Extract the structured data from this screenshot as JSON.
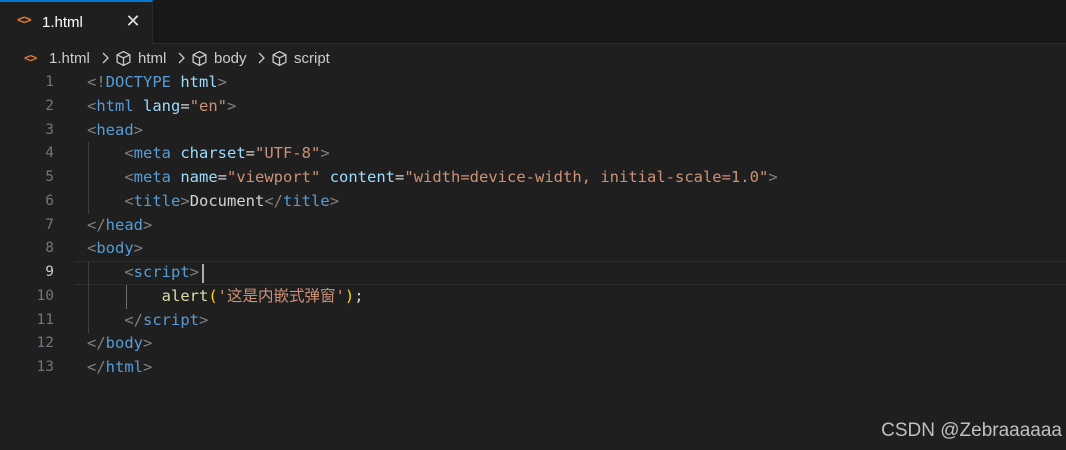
{
  "tab": {
    "icon": "<>",
    "label": "1.html",
    "close": "✕"
  },
  "breadcrumb": {
    "file_icon": "<>",
    "items": [
      "1.html",
      "html",
      "body",
      "script"
    ]
  },
  "line_numbers": [
    "1",
    "2",
    "3",
    "4",
    "5",
    "6",
    "7",
    "8",
    "9",
    "10",
    "11",
    "12",
    "13"
  ],
  "active_line": "9",
  "code": {
    "l1": {
      "a": "<!",
      "b": "DOCTYPE",
      "c": " ",
      "d": "html",
      "e": ">"
    },
    "l2": {
      "a": "<",
      "b": "html",
      "c": " ",
      "d": "lang",
      "e": "=",
      "f": "\"en\"",
      "g": ">"
    },
    "l3": {
      "a": "<",
      "b": "head",
      "c": ">"
    },
    "l4": {
      "ind": "    ",
      "a": "<",
      "b": "meta",
      "c": " ",
      "d": "charset",
      "e": "=",
      "f": "\"UTF-8\"",
      "g": ">"
    },
    "l5": {
      "ind": "    ",
      "a": "<",
      "b": "meta",
      "c": " ",
      "d": "name",
      "e": "=",
      "f": "\"viewport\"",
      "g": " ",
      "h": "content",
      "i": "=",
      "j": "\"width=device-width, initial-scale=1.0\"",
      "k": ">"
    },
    "l6": {
      "ind": "    ",
      "a": "<",
      "b": "title",
      "c": ">",
      "d": "Document",
      "e": "</",
      "f": "title",
      "g": ">"
    },
    "l7": {
      "a": "</",
      "b": "head",
      "c": ">"
    },
    "l8": {
      "a": "<",
      "b": "body",
      "c": ">"
    },
    "l9": {
      "ind": "    ",
      "a": "<",
      "b": "script",
      "c": ">"
    },
    "l10": {
      "ind": "        ",
      "a": "alert",
      "b": "(",
      "c": "'这是内嵌式弹窗'",
      "d": ")",
      "e": ";"
    },
    "l11": {
      "ind": "    ",
      "a": "</",
      "b": "script",
      "c": ">"
    },
    "l12": {
      "a": "</",
      "b": "body",
      "c": ">"
    },
    "l13": {
      "a": "</",
      "b": "html",
      "c": ">"
    }
  },
  "watermark": "CSDN @Zebraaaaaa",
  "colors": {
    "background": "#1f1f1f",
    "tab_accent": "#0078d4",
    "html_icon": "#e37933",
    "tag": "#569cd6",
    "attribute": "#9cdcfe",
    "string": "#ce9178",
    "function": "#dcdcaa",
    "punctuation": "#808080"
  }
}
